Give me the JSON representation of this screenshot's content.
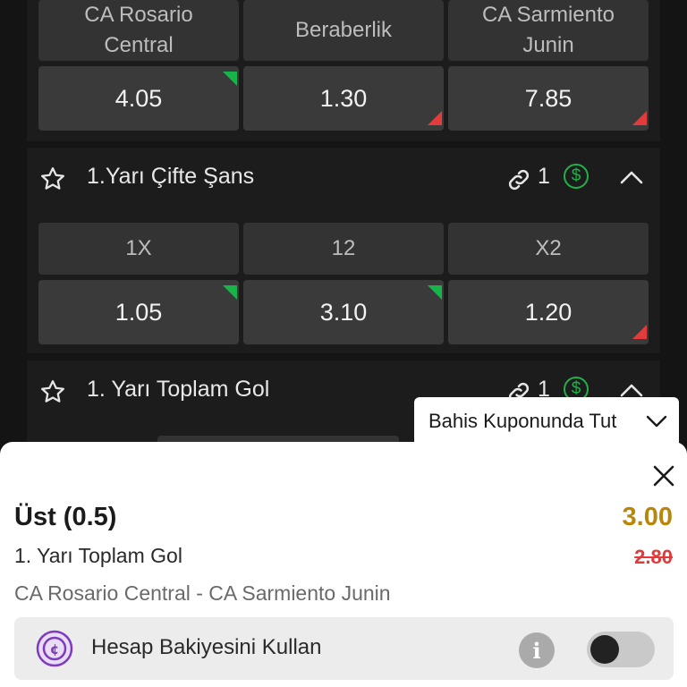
{
  "match_result": {
    "headers": [
      "CA Rosario Central",
      "Beraberlik",
      "CA Sarmiento Junin"
    ],
    "odds": [
      "4.05",
      "1.30",
      "7.85"
    ]
  },
  "double_chance": {
    "title": "1.Yarı Çifte Şans",
    "count": "1",
    "headers": [
      "1X",
      "12",
      "X2"
    ],
    "odds": [
      "1.05",
      "3.10",
      "1.20"
    ]
  },
  "total_goals": {
    "title": "1. Yarı Toplam Gol",
    "count": "1"
  },
  "tooltip": {
    "label": "Bahis Kuponunda Tut"
  },
  "betslip": {
    "selection": "Üst (0.5)",
    "new_odd": "3.00",
    "market": "1. Yarı Toplam Gol",
    "old_odd": "2.80",
    "match": "CA Rosario Central - CA Sarmiento Junin",
    "balance_label": "Hesap Bakiyesini Kullan"
  },
  "icons": [
    "star-icon",
    "link-icon",
    "dollar-icon",
    "chevron-up-icon",
    "chevron-down-icon",
    "close-icon",
    "coin-icon",
    "info-icon"
  ],
  "colors": {
    "up": "#18b34a",
    "down": "#e23b3b",
    "new_odd": "#b8860b",
    "old_odd": "#e03a3a"
  }
}
